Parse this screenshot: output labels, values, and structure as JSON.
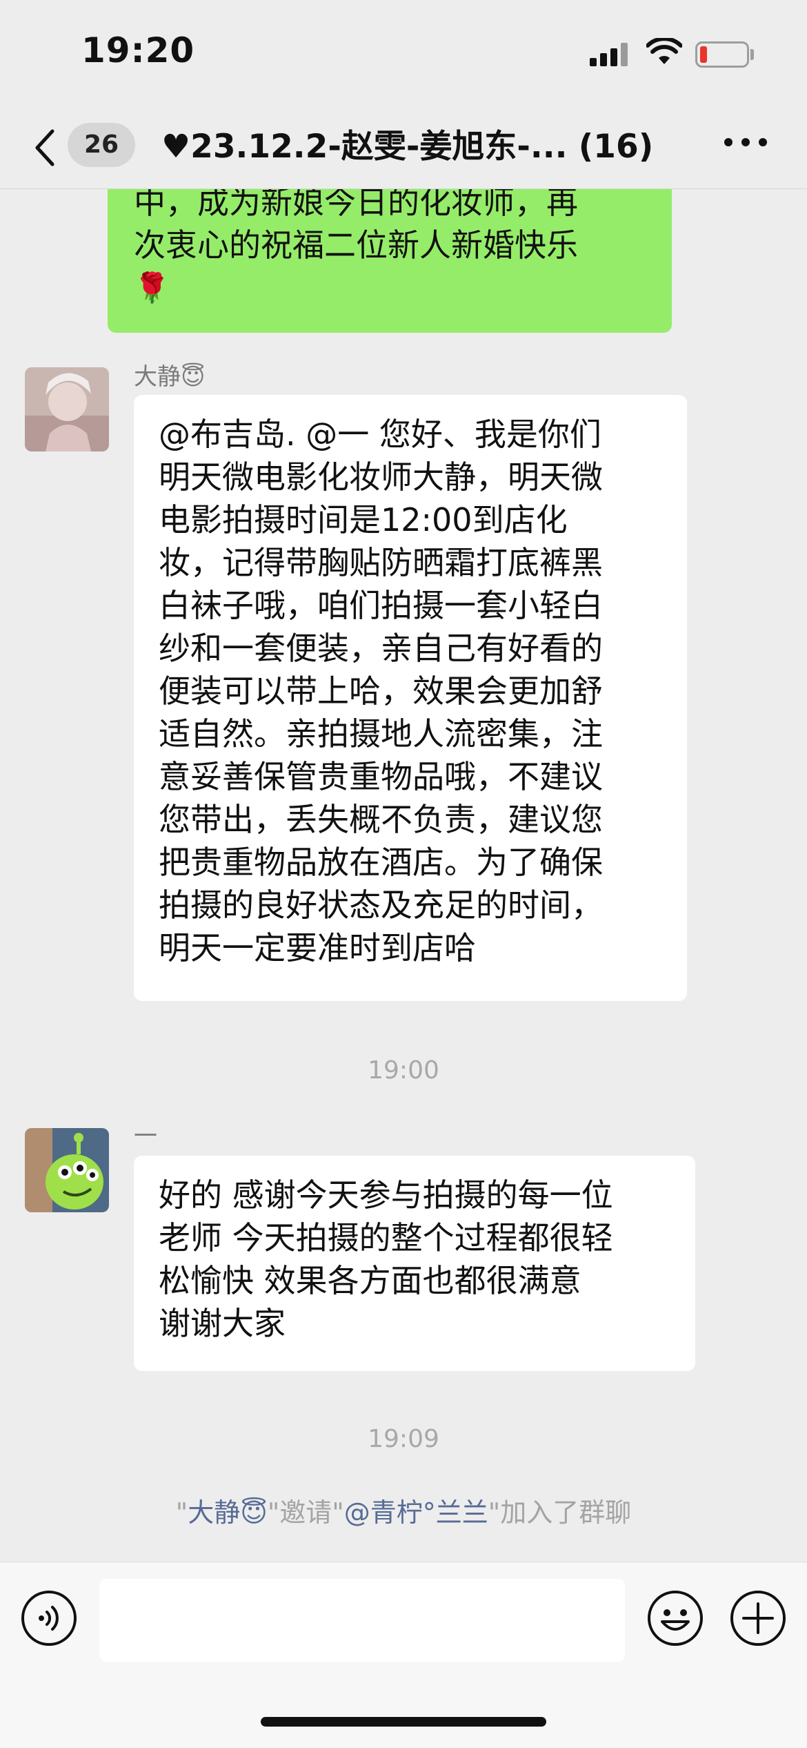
{
  "status_bar": {
    "time": "19:20",
    "battery_color": "#e8362c"
  },
  "nav": {
    "back_icon": "chevron-left-icon",
    "unread_count": "26",
    "title": "♥23.12.2-赵雯-姜旭东-... (16)",
    "more_icon": "more-dots-icon"
  },
  "messages": [
    {
      "type": "outgoing",
      "color": "#95ec69",
      "lines": [
        "中，成为新娘今日的化妆师，再",
        "次衷心的祝福二位新人新婚快乐"
      ],
      "emoji": "🌹"
    },
    {
      "type": "incoming",
      "sender": "大静😇",
      "lines": [
        "@布吉岛. @一 您好、我是你们",
        "明天微电影化妆师大静，明天微",
        "电影拍摄时间是12:00到店化",
        "妆，记得带胸贴防晒霜打底裤黑",
        "白袜子哦，咱们拍摄一套小轻白",
        "纱和一套便装，亲自己有好看的",
        "便装可以带上哈，效果会更加舒",
        "适自然。亲拍摄地人流密集，注",
        "意妥善保管贵重物品哦，不建议",
        "您带出，丢失概不负责，建议您",
        "把贵重物品放在酒店。为了确保",
        "拍摄的良好状态及充足的时间，",
        "明天一定要准时到店哈"
      ]
    },
    {
      "type": "time",
      "text": "19:00"
    },
    {
      "type": "incoming",
      "sender": "一",
      "lines": [
        "好的 感谢今天参与拍摄的每一位",
        "老师 今天拍摄的整个过程都很轻",
        "松愉快 效果各方面也都很满意",
        "谢谢大家"
      ]
    },
    {
      "type": "time",
      "text": "19:09"
    },
    {
      "type": "system",
      "q1": "\"",
      "inviter": "大静😇",
      "mid": "\"邀请\"",
      "invitee": "@青柠°兰兰",
      "tail": "\"加入了群聊"
    }
  ],
  "input_bar": {
    "voice_icon": "voice-icon",
    "emoji_icon": "smiley-icon",
    "plus_icon": "plus-circle-icon",
    "placeholder": ""
  }
}
